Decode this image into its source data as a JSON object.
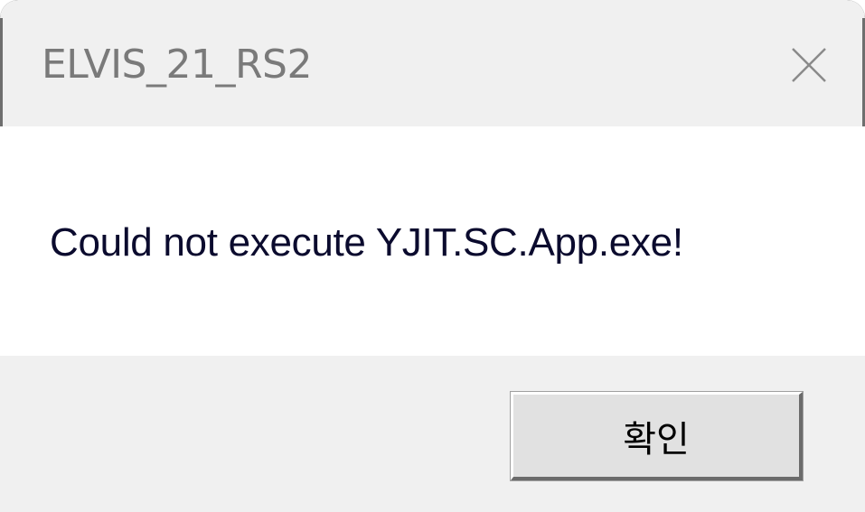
{
  "window": {
    "title": "ELVIS_21_RS2",
    "close_icon": "close-icon"
  },
  "content": {
    "message": "Could not execute YJIT.SC.App.exe!"
  },
  "footer": {
    "ok_label": "확인"
  }
}
